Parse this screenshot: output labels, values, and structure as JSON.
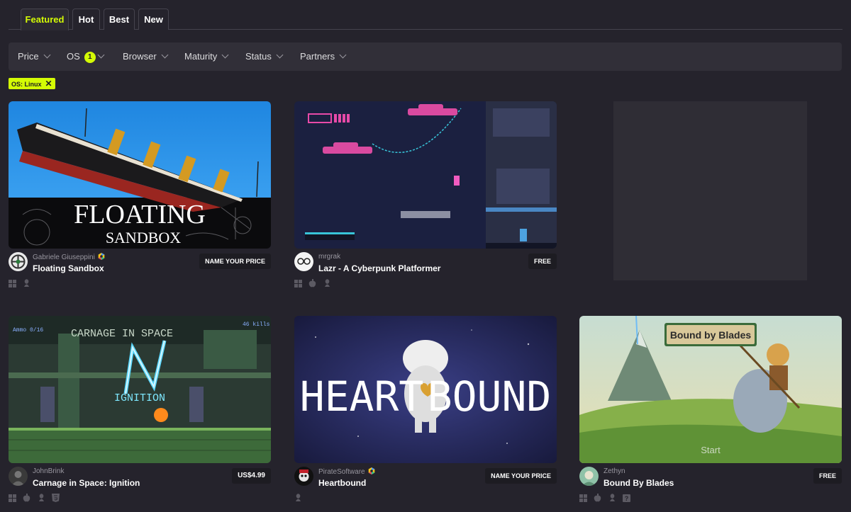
{
  "tabs": [
    {
      "label": "Featured",
      "active": true
    },
    {
      "label": "Hot",
      "active": false
    },
    {
      "label": "Best",
      "active": false
    },
    {
      "label": "New",
      "active": false
    }
  ],
  "filters": [
    {
      "label": "Price"
    },
    {
      "label": "OS",
      "badge": "1"
    },
    {
      "label": "Browser"
    },
    {
      "label": "Maturity"
    },
    {
      "label": "Status"
    },
    {
      "label": "Partners"
    }
  ],
  "active_tag": {
    "label": "OS: Linux",
    "remove_icon": "close-icon"
  },
  "colors": {
    "accent": "#d4fb05",
    "background": "#25232c",
    "panel": "#312f38",
    "verified_badge": [
      "#4f9cf7",
      "#f5c518",
      "#e84a5f",
      "#36c58b"
    ]
  },
  "games": [
    {
      "author": "Gabriele Giuseppini",
      "verified": true,
      "title": "Floating Sandbox",
      "price": "NAME YOUR PRICE",
      "platforms": [
        "windows-icon",
        "linux-icon"
      ],
      "thumb_text": [
        "FLOATING",
        "SANDBOX"
      ]
    },
    {
      "author": "mrgrak",
      "verified": false,
      "title": "Lazr - A Cyberpunk Platformer",
      "price": "FREE",
      "platforms": [
        "windows-icon",
        "apple-icon",
        "linux-icon"
      ]
    },
    {
      "author": "JohnBrink",
      "verified": false,
      "title": "Carnage in Space: Ignition",
      "price": "US$4.99",
      "platforms": [
        "windows-icon",
        "apple-icon",
        "linux-icon",
        "html5-icon"
      ],
      "thumb_text": [
        "CARNAGE IN SPACE",
        "IGNITION",
        "Ammo 0/16",
        "46 kills"
      ]
    },
    {
      "author": "PirateSoftware",
      "verified": true,
      "title": "Heartbound",
      "price": "NAME YOUR PRICE",
      "platforms": [
        "linux-icon"
      ],
      "thumb_text": [
        "HEART",
        "BOUND"
      ]
    },
    {
      "author": "Zethyn",
      "verified": false,
      "title": "Bound By Blades",
      "price": "FREE",
      "platforms": [
        "windows-icon",
        "apple-icon",
        "linux-icon",
        "unknown-platform-icon"
      ],
      "thumb_text": [
        "Bound by Blades",
        "Start"
      ]
    }
  ]
}
